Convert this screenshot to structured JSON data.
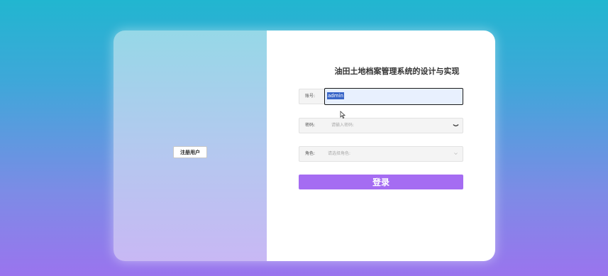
{
  "left_panel": {
    "register_label": "注册用户"
  },
  "form": {
    "title": "油田土地档案管理系统的设计与实现",
    "account": {
      "label": "账号:",
      "value": "admin"
    },
    "password": {
      "label": "密码:",
      "placeholder": "请输入密码:"
    },
    "role": {
      "label": "角色:",
      "placeholder": "请选择角色:"
    },
    "login_label": "登录"
  },
  "icons": {
    "password_toggle": "eye-icon",
    "role_dropdown": "chevron-down-icon",
    "mouse": "cursor-icon"
  },
  "colors": {
    "login_button": "#a56cf2",
    "selection": "#3a66c8",
    "input_focus_bg": "#e8f0fe"
  }
}
